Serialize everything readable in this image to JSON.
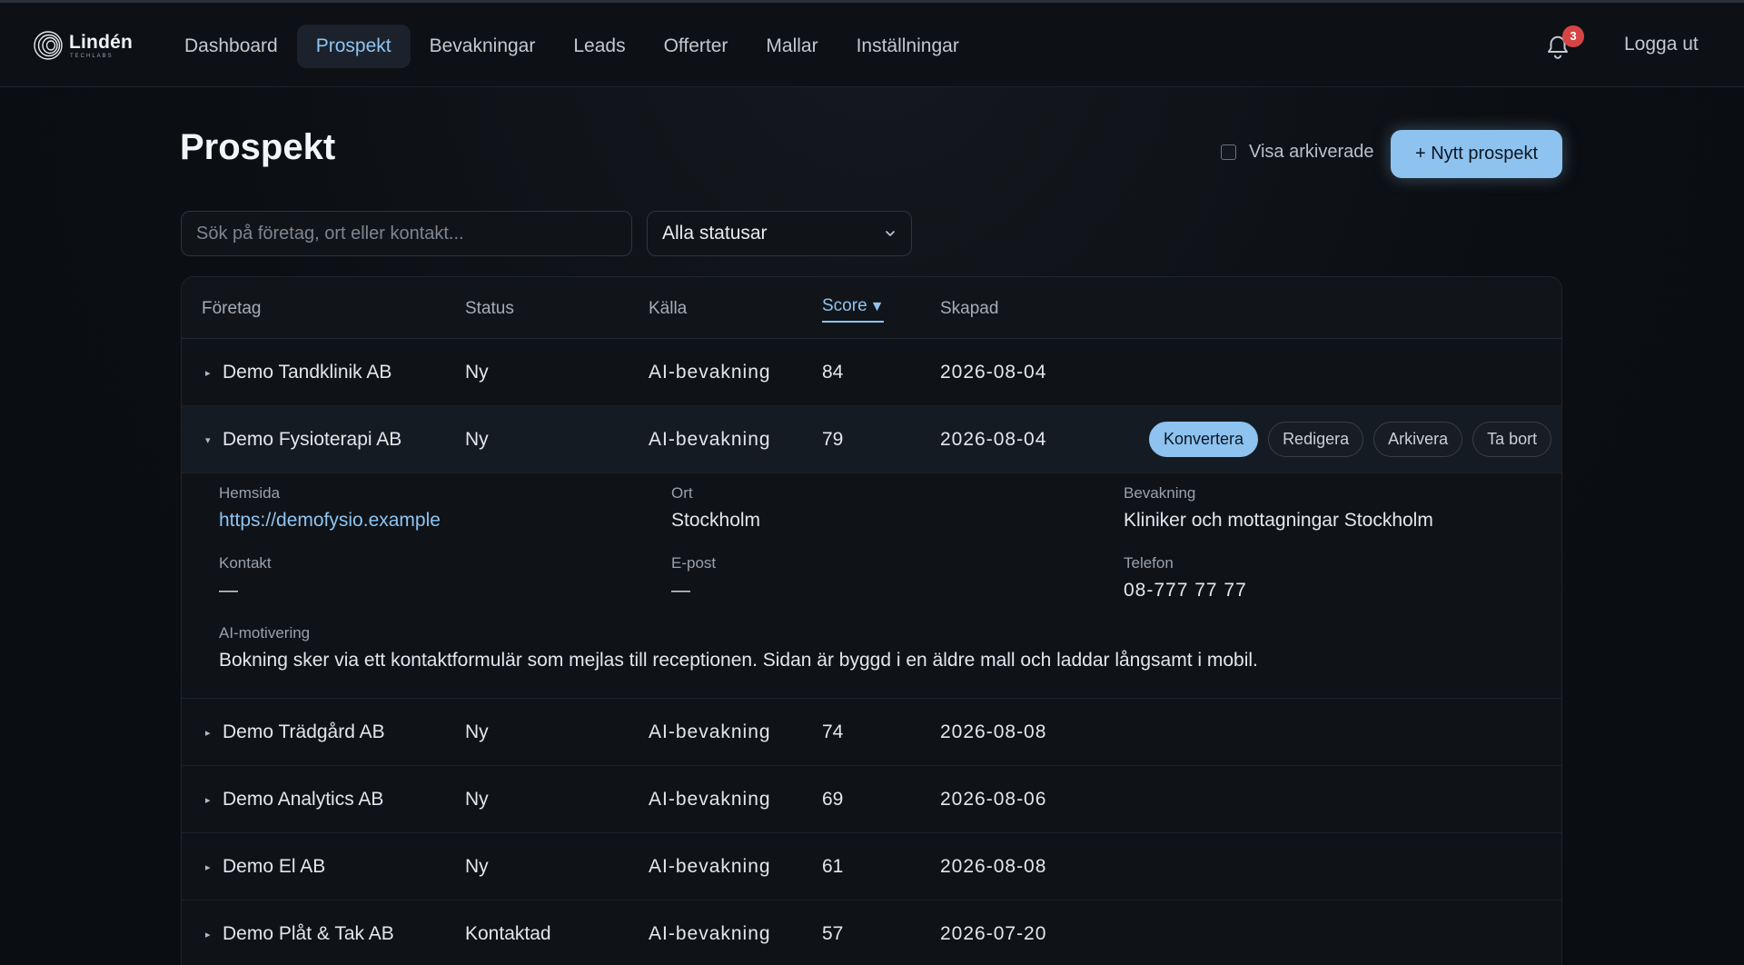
{
  "brand": {
    "name": "Lindén",
    "sub": "TECHLABS"
  },
  "nav": {
    "items": [
      {
        "label": "Dashboard",
        "active": false
      },
      {
        "label": "Prospekt",
        "active": true
      },
      {
        "label": "Bevakningar",
        "active": false
      },
      {
        "label": "Leads",
        "active": false
      },
      {
        "label": "Offerter",
        "active": false
      },
      {
        "label": "Mallar",
        "active": false
      },
      {
        "label": "Inställningar",
        "active": false
      }
    ],
    "notification_count": "3",
    "logout_label": "Logga ut"
  },
  "page": {
    "title": "Prospekt",
    "show_archived_label": "Visa arkiverade",
    "new_button_label": "+ Nytt prospekt"
  },
  "filters": {
    "search_placeholder": "Sök på företag, ort eller kontakt...",
    "status_selected": "Alla statusar"
  },
  "table": {
    "columns": [
      {
        "label": "Företag"
      },
      {
        "label": "Status"
      },
      {
        "label": "Källa"
      },
      {
        "label": "Score",
        "sort_indicator": "▼"
      },
      {
        "label": "Skapad"
      }
    ],
    "rows": [
      {
        "company": "Demo Tandklinik AB",
        "status": "Ny",
        "source": "AI-bevakning",
        "score": "84",
        "created": "2026-08-04",
        "caret": "▸"
      },
      {
        "company": "Demo Fysioterapi AB",
        "status": "Ny",
        "source": "AI-bevakning",
        "score": "79",
        "created": "2026-08-04",
        "caret": "▾"
      },
      {
        "company": "Demo Trädgård AB",
        "status": "Ny",
        "source": "AI-bevakning",
        "score": "74",
        "created": "2026-08-08",
        "caret": "▸"
      },
      {
        "company": "Demo Analytics AB",
        "status": "Ny",
        "source": "AI-bevakning",
        "score": "69",
        "created": "2026-08-06",
        "caret": "▸"
      },
      {
        "company": "Demo El AB",
        "status": "Ny",
        "source": "AI-bevakning",
        "score": "61",
        "created": "2026-08-08",
        "caret": "▸"
      },
      {
        "company": "Demo Plåt & Tak AB",
        "status": "Kontaktad",
        "source": "AI-bevakning",
        "score": "57",
        "created": "2026-07-20",
        "caret": "▸"
      }
    ],
    "row_actions": {
      "convert": "Konvertera",
      "edit": "Redigera",
      "archive": "Arkivera",
      "delete": "Ta bort"
    },
    "expanded_details": {
      "website_label": "Hemsida",
      "website_value": "https://demofysio.example",
      "city_label": "Ort",
      "city_value": "Stockholm",
      "watch_label": "Bevakning",
      "watch_value": "Kliniker och mottagningar Stockholm",
      "contact_label": "Kontakt",
      "contact_value": "—",
      "email_label": "E-post",
      "email_value": "—",
      "phone_label": "Telefon",
      "phone_value": "08-777 77 77",
      "ai_label": "AI-motivering",
      "ai_value": "Bokning sker via ett kontaktformulär som mejlas till receptionen. Sidan är byggd i en äldre mall och laddar långsamt i mobil."
    }
  },
  "colors": {
    "accent": "#8ec2ef",
    "badge": "#d64545",
    "background": "#0b0e12"
  }
}
